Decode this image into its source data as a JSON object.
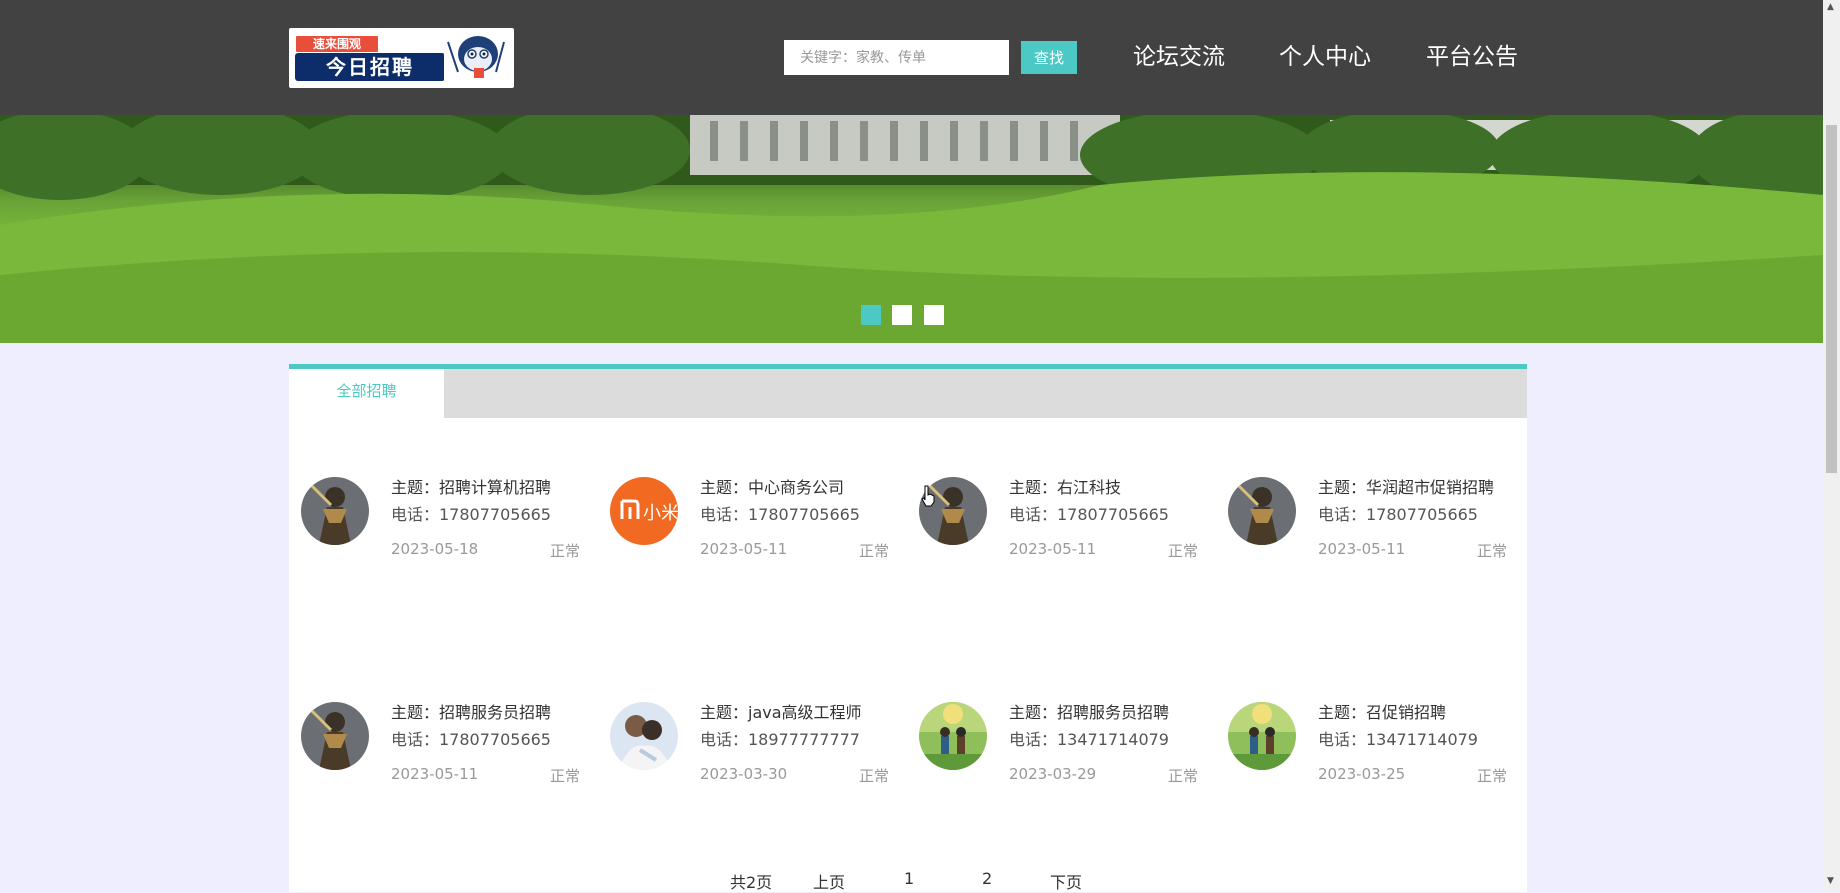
{
  "header": {
    "logo": {
      "badge_text": "速来围观",
      "main_text": "今日招聘"
    },
    "search": {
      "placeholder": "关键字：家教、传单",
      "button_label": "查找"
    },
    "nav": [
      "论坛交流",
      "个人中心",
      "平台公告"
    ]
  },
  "banner": {
    "slide_count": 3,
    "active_slide": 1
  },
  "colors": {
    "accent": "#4cc9c4",
    "header_bg": "#424242",
    "page_bg": "#eeeefe"
  },
  "tabs": [
    {
      "label": "全部招聘",
      "active": true
    }
  ],
  "listings": [
    {
      "title": "主题：招聘计算机招聘",
      "phone": "电话：17807705665",
      "date": "2023-05-18",
      "status": "正常",
      "avatar": "warrior-avatar"
    },
    {
      "title": "主题：中心商务公司",
      "phone": "电话：17807705665",
      "date": "2023-05-11",
      "status": "正常",
      "avatar": "xiaomi-logo-avatar"
    },
    {
      "title": "主题：右江科技",
      "phone": "电话：17807705665",
      "date": "2023-05-11",
      "status": "正常",
      "avatar": "warrior-avatar"
    },
    {
      "title": "主题：华润超市促销招聘",
      "phone": "电话：17807705665",
      "date": "2023-05-11",
      "status": "正常",
      "avatar": "warrior-avatar"
    },
    {
      "title": "主题：招聘服务员招聘",
      "phone": "电话：17807705665",
      "date": "2023-05-11",
      "status": "正常",
      "avatar": "warrior-avatar"
    },
    {
      "title": "主题：java高级工程师",
      "phone": "电话：18977777777",
      "date": "2023-03-30",
      "status": "正常",
      "avatar": "couple-photo-avatar"
    },
    {
      "title": "主题：招聘服务员招聘",
      "phone": "电话：13471714079",
      "date": "2023-03-29",
      "status": "正常",
      "avatar": "anime-scene-avatar"
    },
    {
      "title": "主题：召促销招聘",
      "phone": "电话：13471714079",
      "date": "2023-03-25",
      "status": "正常",
      "avatar": "anime-scene-avatar"
    }
  ],
  "pagination": {
    "total": "共2页",
    "prev": "上页",
    "pages": [
      "1",
      "2"
    ],
    "next": "下页"
  }
}
